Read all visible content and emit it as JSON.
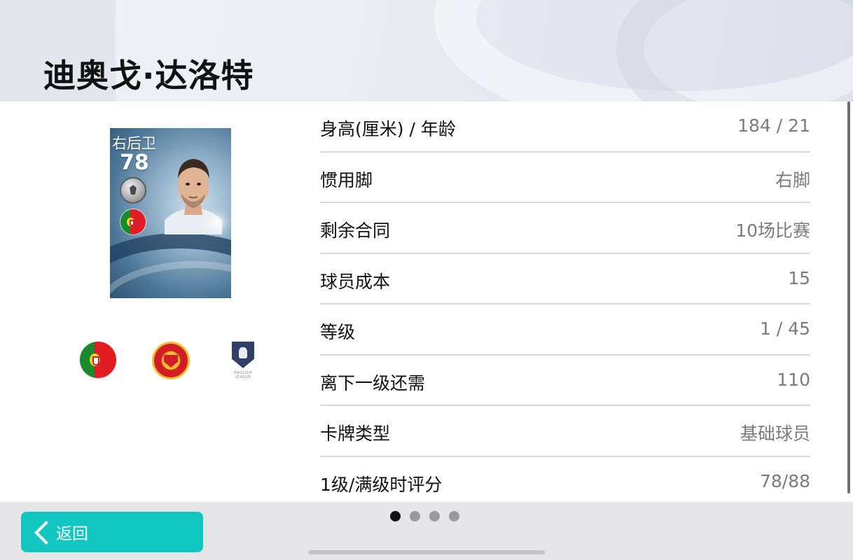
{
  "header": {
    "player_name": "迪奥戈·达洛特"
  },
  "card": {
    "position": "右后卫",
    "rating": "78",
    "nationality_flag": "portugal-flag-icon",
    "badge_icon": "silver-badge-icon"
  },
  "affiliations": {
    "nation_icon": "portugal-flag-icon",
    "club_icon": "manchester-united-crest-icon",
    "league_icon": "english-league-icon",
    "league_text": "ENGLISH LEAGUE"
  },
  "stats": [
    {
      "label": "身高(厘米) / 年龄",
      "value": "184 / 21"
    },
    {
      "label": "惯用脚",
      "value": "右脚"
    },
    {
      "label": "剩余合同",
      "value": "10场比赛"
    },
    {
      "label": "球员成本",
      "value": "15"
    },
    {
      "label": "等级",
      "value": "1 / 45"
    },
    {
      "label": "离下一级还需",
      "value": "110"
    },
    {
      "label": "卡牌类型",
      "value": "基础球员"
    },
    {
      "label": "1级/满级时评分",
      "value": "78/88"
    }
  ],
  "footer": {
    "back_label": "返回",
    "page_indicator": {
      "total": 4,
      "current": 1
    }
  },
  "colors": {
    "accent": "#12c7c1",
    "footer_bg": "#e6e6e9",
    "value_text": "#7b7b7b"
  }
}
